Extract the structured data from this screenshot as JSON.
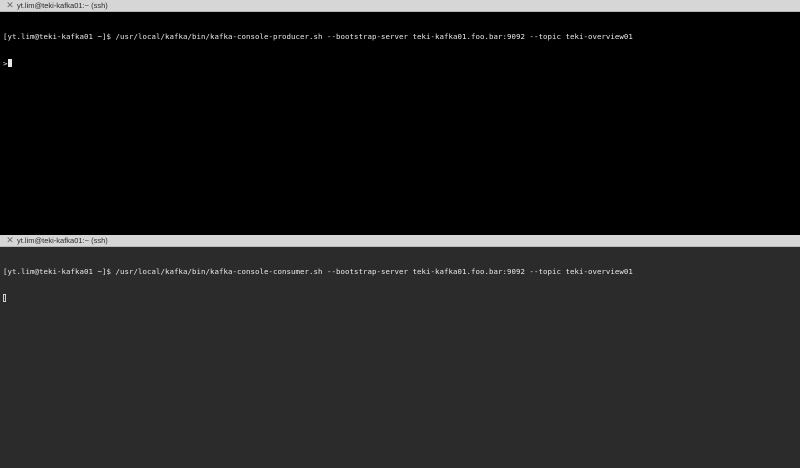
{
  "top_pane": {
    "tab_close_icon": "close-icon",
    "tab_title": "yt.lim@teki-kafka01:~ (ssh)",
    "prompt_line": "[yt.lim@teki-kafka01 ~]$ /usr/local/kafka/bin/kafka-console-producer.sh --bootstrap-server teki-kafka01.foo.bar:9092 --topic teki-overview01",
    "input_prompt": ">",
    "background_color": "#000000",
    "text_color": "#e8e8e8"
  },
  "bottom_pane": {
    "tab_close_icon": "close-icon",
    "tab_title": "yt.lim@teki-kafka01:~ (ssh)",
    "prompt_line": "[yt.lim@teki-kafka01 ~]$ /usr/local/kafka/bin/kafka-console-consumer.sh --bootstrap-server teki-kafka01.foo.bar:9092 --topic teki-overview01",
    "background_color": "#2b2b2b",
    "text_color": "#e8e8e8"
  },
  "tabbar_color": "#d6d6d6"
}
